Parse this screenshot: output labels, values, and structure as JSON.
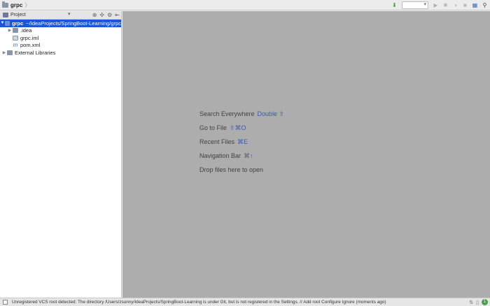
{
  "breadcrumb": {
    "project": "grpc",
    "arrow": "〉"
  },
  "toolbar": {
    "run_config_value": "",
    "icons": [
      "build-icon",
      "run-icon",
      "debug-icon",
      "coverage-icon",
      "stop-icon",
      "project-structure-icon",
      "search-icon"
    ]
  },
  "project_panel": {
    "title": "Project",
    "dropdown_arrow": "▾",
    "header_icons": {
      "sync": "⊕",
      "scroll": "✣",
      "settings": "⚙",
      "hide": "⇤"
    },
    "tree": [
      {
        "toggle": "▼",
        "icon": "folder-icon",
        "name": "grpc",
        "path": "~/IdeaProjects/SpringBoot-Learning/grpc",
        "selected": true
      },
      {
        "toggle": "▶",
        "icon": "folder-icon",
        "name": ".idea",
        "path": ""
      },
      {
        "toggle": "",
        "icon": "iml-file-icon",
        "name": "grpc.iml",
        "path": ""
      },
      {
        "toggle": "",
        "icon": "maven-icon",
        "name": "pom.xml",
        "path": ""
      },
      {
        "toggle": "▶",
        "icon": "libraries-icon",
        "name": "External Libraries",
        "path": ""
      }
    ]
  },
  "editor": {
    "hints": [
      {
        "text": "Search Everywhere",
        "key": "Double ⇧"
      },
      {
        "text": "Go to File",
        "key": "⇧⌘O"
      },
      {
        "text": "Recent Files",
        "key": "⌘E"
      },
      {
        "text": "Navigation Bar",
        "key": "⌘↑"
      },
      {
        "text": "Drop files here to open",
        "key": ""
      }
    ]
  },
  "statusbar": {
    "message": "Unregistered VCS root detected: The directory /Users/zsunny/IdeaProjects/SpringBoot-Learning is under Git, but is not registered in the Settings. // Add root  Configure  Ignore (moments ago)",
    "right_icons": [
      "⇅",
      "▯"
    ],
    "event_count": "1"
  },
  "colors": {
    "selection": "#1e54d6",
    "editor_bg": "#adadad",
    "shortcut": "#3a5ba8"
  }
}
